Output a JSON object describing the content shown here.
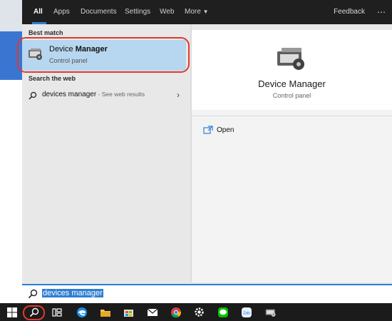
{
  "tabs": [
    {
      "label": "All"
    },
    {
      "label": "Apps"
    },
    {
      "label": "Documents"
    },
    {
      "label": "Settings"
    },
    {
      "label": "Web"
    },
    {
      "label": "More"
    }
  ],
  "feedback_label": "Feedback",
  "more_icon": "ellipsis-icon",
  "best_match": {
    "section_label": "Best match",
    "title_normal": "Device ",
    "title_bold": "Manager",
    "subtitle": "Control panel"
  },
  "search_web": {
    "section_label": "Search the web",
    "query": "devices manager",
    "suffix": " - See web results"
  },
  "preview": {
    "title": "Device Manager",
    "subtitle": "Control panel",
    "action_open": "Open"
  },
  "search_bar": {
    "value": "devices manager"
  },
  "taskbar": {
    "items": [
      {
        "name": "windows-start-icon"
      },
      {
        "name": "search-icon"
      },
      {
        "name": "task-view-icon"
      },
      {
        "name": "edge-icon"
      },
      {
        "name": "file-explorer-icon"
      },
      {
        "name": "store-icon"
      },
      {
        "name": "mail-icon"
      },
      {
        "name": "chrome-icon"
      },
      {
        "name": "settings-icon"
      },
      {
        "name": "line-icon"
      },
      {
        "name": "zalo-icon"
      },
      {
        "name": "device-manager-icon"
      }
    ],
    "zalo_label": "Zalo"
  },
  "colors": {
    "accent": "#2f7fd3",
    "highlight": "#e0392f",
    "selected_row": "#b7d6ef",
    "topbar": "#1f1f1f"
  }
}
